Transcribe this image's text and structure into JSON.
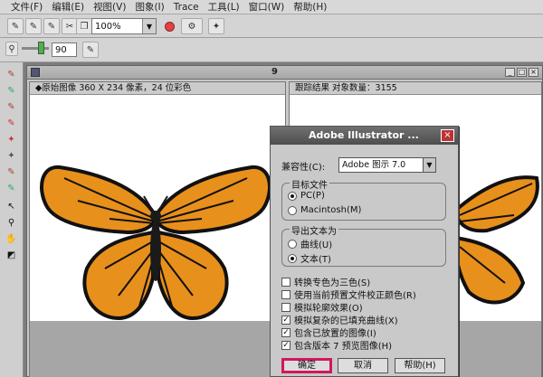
{
  "menu": [
    "文件(F)",
    "编辑(E)",
    "视图(V)",
    "图象(I)",
    "Trace",
    "工具(L)",
    "窗口(W)",
    "帮助(H)"
  ],
  "toolbar": {
    "zoom": "100%",
    "tolerance": "90"
  },
  "document": {
    "title_num": "9"
  },
  "left_pane": {
    "header": "◆原始图像  360 X 234 像素，24 位彩色"
  },
  "right_pane": {
    "header": "跟踪结果  对象数量：3155"
  },
  "dialog": {
    "title": "Adobe Illustrator ...",
    "close_glyph": "×",
    "compat_label": "兼容性(C):",
    "compat_value": "Adobe 图示 7.0",
    "target_group": "目标文件",
    "target_options": [
      "PC(P)",
      "Macintosh(M)"
    ],
    "text_group": "导出文本为",
    "text_options": [
      "曲线(U)",
      "文本(T)"
    ],
    "checkboxes": [
      {
        "label": "转换专色为三色(S)",
        "checked": false
      },
      {
        "label": "使用当前预置文件校正颜色(R)",
        "checked": false
      },
      {
        "label": "模拟轮廓效果(O)",
        "checked": false
      },
      {
        "label": "模拟复杂的已填充曲线(X)",
        "checked": true
      },
      {
        "label": "包含已放置的图像(I)",
        "checked": true
      },
      {
        "label": "包含版本 7 预览图像(H)",
        "checked": true
      }
    ],
    "ok": "确定",
    "cancel": "取消",
    "help": "帮助(H)"
  },
  "colors": {
    "accent": "#d0185e",
    "wing": "#e8901c"
  }
}
